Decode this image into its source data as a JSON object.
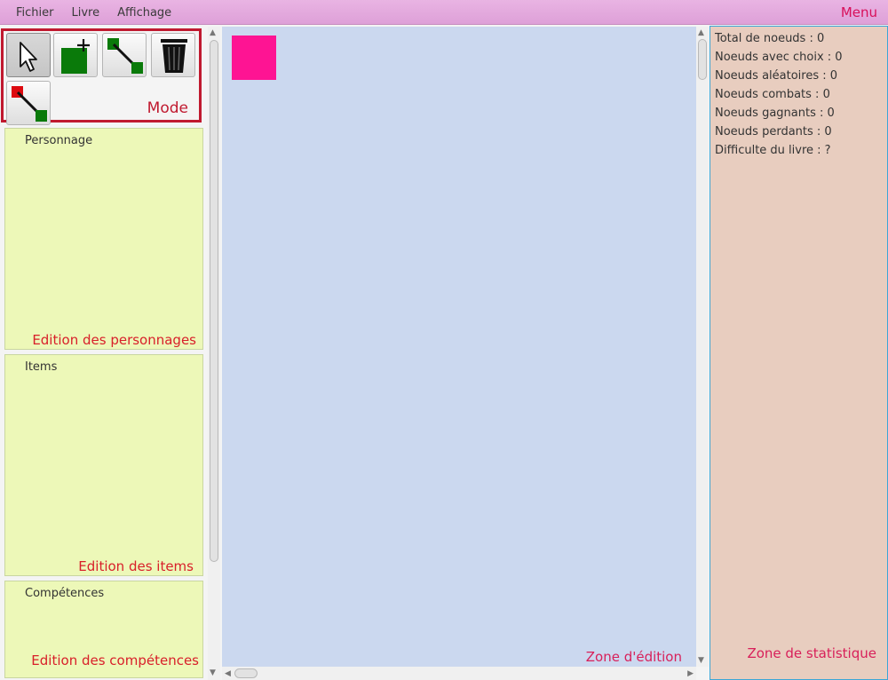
{
  "menubar": {
    "items": [
      "Fichier",
      "Livre",
      "Affichage"
    ],
    "label": "Menu"
  },
  "mode": {
    "label": "Mode",
    "tools": [
      {
        "name": "select-tool",
        "icon": "arrow-cursor-icon",
        "selected": true
      },
      {
        "name": "add-node-tool",
        "icon": "add-node-icon",
        "selected": false
      },
      {
        "name": "link-tool",
        "icon": "link-nodes-icon",
        "selected": false
      },
      {
        "name": "delete-tool",
        "icon": "trash-icon",
        "selected": false
      },
      {
        "name": "link-variant-tool",
        "icon": "link-red-green-icon",
        "selected": false
      }
    ]
  },
  "sections": {
    "characters": {
      "title": "Personnage",
      "label": "Edition des personnages"
    },
    "items": {
      "title": "Items",
      "label": "Edition des items"
    },
    "skills": {
      "title": "Compétences",
      "label": "Edition des compétences"
    }
  },
  "editor": {
    "label": "Zone d'édition",
    "node_color": "#fe1493"
  },
  "stats": {
    "label": "Zone de statistique",
    "lines": [
      "Total de noeuds : 0",
      "Noeuds avec choix : 0",
      "Noeuds aléatoires : 0",
      "Noeuds combats : 0",
      "Noeuds gagnants : 0",
      "Noeuds perdants : 0",
      "Difficulte du livre : ?"
    ]
  },
  "colors": {
    "menubar": "#dea0d8",
    "accent_red": "#c0192f",
    "section_bg": "#edf8b8",
    "editor_bg": "#cbd8ef",
    "stats_bg": "#e8cdbf",
    "label": "#d8205a"
  }
}
